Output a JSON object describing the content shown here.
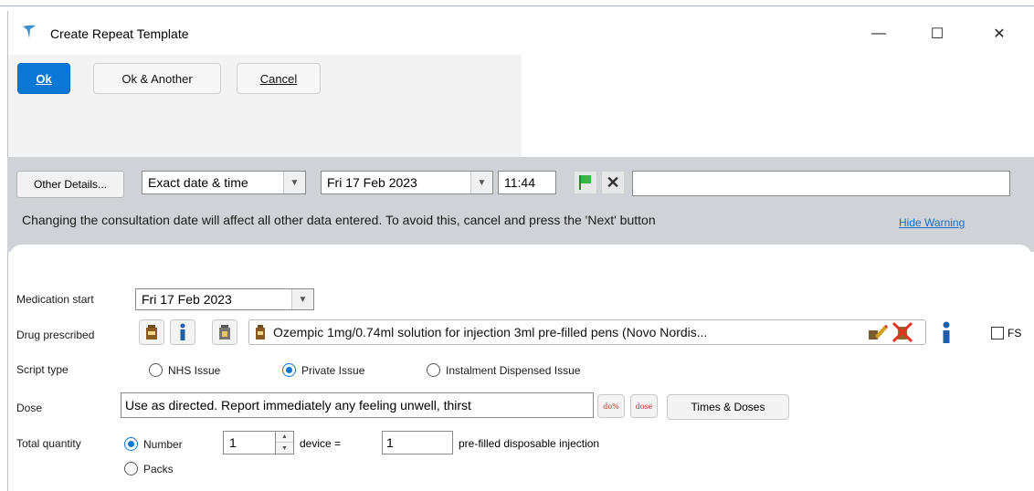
{
  "window": {
    "title": "Create Repeat Template",
    "minimize_glyph": "—",
    "maximize_glyph": "☐",
    "close_glyph": "✕"
  },
  "toolbar": {
    "ok_label": "Ok",
    "ok_another_label": "Ok & Another",
    "cancel_label": "Cancel"
  },
  "consultation": {
    "other_details_label": "Other Details...",
    "date_mode": "Exact date & time",
    "date": "Fri 17 Feb 2023",
    "time": "11:44",
    "free_text": "",
    "warning": "Changing the consultation date will affect all other data entered. To avoid this, cancel and press the 'Next' button",
    "hide_warning_label": "Hide Warning"
  },
  "form": {
    "medication_start_label": "Medication start",
    "medication_start_value": "Fri 17 Feb 2023",
    "drug_prescribed_label": "Drug prescribed",
    "drug_name": "Ozempic 1mg/0.74ml solution for injection 3ml pre-filled pens (Novo Nordis...",
    "fs_label": "FS",
    "script_type_label": "Script type",
    "script_types": [
      "NHS Issue",
      "Private Issue",
      "Instalment Dispensed Issue"
    ],
    "script_type_selected": "Private Issue",
    "dose_label": "Dose",
    "dose_value": "Use as directed.  Report immediately any feeling unwell, thirst",
    "dose_icon1": "do%",
    "dose_icon2": "dose",
    "times_doses_label": "Times & Doses",
    "total_quantity_label": "Total quantity",
    "number_label": "Number",
    "packs_label": "Packs",
    "quantity_mode_selected": "Number",
    "quantity": "1",
    "device_label": "device  =",
    "quantity_units": "1",
    "unit_label": "pre-filled disposable injection"
  },
  "colors": {
    "accent": "#0a78d4",
    "band": "#cfd3d7",
    "link": "#1a6bbf"
  },
  "icons": [
    "app-icon",
    "flag-icon",
    "clear-icon",
    "bottle-icon",
    "info-icon",
    "drug-edit-icon",
    "drug-remove-icon"
  ]
}
